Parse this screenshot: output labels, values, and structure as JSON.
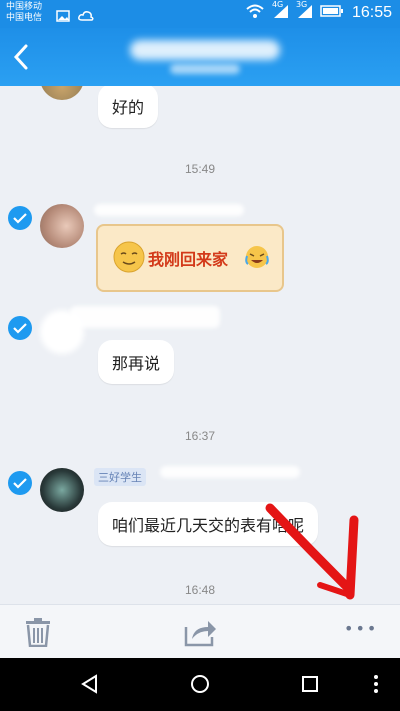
{
  "status_bar": {
    "carrier_1": "中国移动",
    "carrier_2": "中国电信",
    "net_1": "4G",
    "net_2": "3G",
    "time": "16:55",
    "icons": [
      "image-icon",
      "cloud-icon",
      "wifi-icon",
      "signal-icon",
      "signal-icon",
      "battery-icon"
    ]
  },
  "header": {
    "back_icon": "chevron-left-icon"
  },
  "messages": [
    {
      "type": "text",
      "text": "好的"
    },
    {
      "type": "time",
      "text": "15:49"
    },
    {
      "type": "sticker",
      "text": "我刚回来家"
    },
    {
      "type": "text",
      "text": "那再说"
    },
    {
      "type": "time",
      "text": "16:37"
    },
    {
      "type": "text",
      "sender_tag": "三好学生",
      "text": "咱们最近几天交的表有啥呢"
    },
    {
      "type": "time",
      "text": "16:48"
    }
  ],
  "toolbar": {
    "icons": [
      "trash-icon",
      "share-icon",
      "more-icon"
    ],
    "more_label": "•••"
  },
  "navbar": {
    "icons": [
      "back-triangle-icon",
      "home-circle-icon",
      "recents-square-icon",
      "menu-dots-icon"
    ]
  },
  "colors": {
    "accent": "#1e8fe8",
    "check": "#1e9af0",
    "annotation": "#e41515",
    "background": "#edf0f5"
  }
}
